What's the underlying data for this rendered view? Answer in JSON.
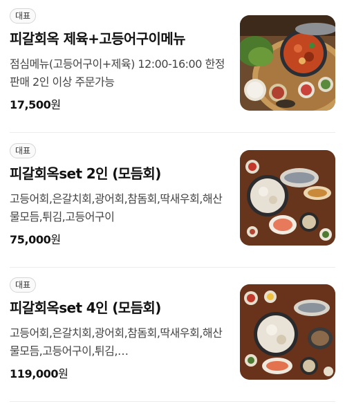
{
  "menu": {
    "items": [
      {
        "badge": "대표",
        "title": "피갈회옥 제육+고등어구이메뉴",
        "description": "점심메뉴(고등어구이+제육) 12:00-16:00 한정판매 2인 이상 주문가능",
        "price": "17,500",
        "currency": "원",
        "image_icon": "food-photo-stirfried-pork-set"
      },
      {
        "badge": "대표",
        "title": "피갈회옥set 2인 (모듬회)",
        "description": "고등어회,은갈치회,광어회,참돔회,딱새우회,해산물모듬,튀김,고등어구이",
        "price": "75,000",
        "currency": "원",
        "image_icon": "food-photo-sashimi-set-2"
      },
      {
        "badge": "대표",
        "title": "피갈회옥set 4인 (모듬회)",
        "description": "고등어회,은갈치회,광어회,참돔회,딱새우회,해산물모듬,고등어구이,튀김,…",
        "price": "119,000",
        "currency": "원",
        "image_icon": "food-photo-sashimi-set-4"
      }
    ]
  }
}
